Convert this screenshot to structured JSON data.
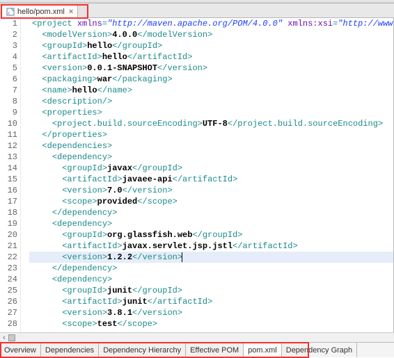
{
  "tab": {
    "label": "hello/pom.xml",
    "close": "×"
  },
  "lines": [
    {
      "n": 1,
      "segs": [
        {
          "c": "t-tag",
          "t": "<project "
        },
        {
          "c": "t-attr",
          "t": "xmlns"
        },
        {
          "c": "t-tag",
          "t": "="
        },
        {
          "c": "t-str",
          "t": "\"http://maven.apache.org/POM/4.0.0\""
        },
        {
          "c": "t-tag",
          "t": " "
        },
        {
          "c": "t-attr",
          "t": "xmlns:xsi"
        },
        {
          "c": "t-tag",
          "t": "="
        },
        {
          "c": "t-str",
          "t": "\"http://www.w"
        }
      ],
      "i": 0
    },
    {
      "n": 2,
      "segs": [
        {
          "c": "t-tag",
          "t": "<modelVersion>"
        },
        {
          "c": "t-text",
          "t": "4.0.0"
        },
        {
          "c": "t-tag",
          "t": "</modelVersion>"
        }
      ],
      "i": 1
    },
    {
      "n": 3,
      "segs": [
        {
          "c": "t-tag",
          "t": "<groupId>"
        },
        {
          "c": "t-text",
          "t": "hello"
        },
        {
          "c": "t-tag",
          "t": "</groupId>"
        }
      ],
      "i": 1
    },
    {
      "n": 4,
      "segs": [
        {
          "c": "t-tag",
          "t": "<artifactId>"
        },
        {
          "c": "t-text",
          "t": "hello"
        },
        {
          "c": "t-tag",
          "t": "</artifactId>"
        }
      ],
      "i": 1
    },
    {
      "n": 5,
      "segs": [
        {
          "c": "t-tag",
          "t": "<version>"
        },
        {
          "c": "t-text",
          "t": "0.0.1-SNAPSHOT"
        },
        {
          "c": "t-tag",
          "t": "</version>"
        }
      ],
      "i": 1
    },
    {
      "n": 6,
      "segs": [
        {
          "c": "t-tag",
          "t": "<packaging>"
        },
        {
          "c": "t-text",
          "t": "war"
        },
        {
          "c": "t-tag",
          "t": "</packaging>"
        }
      ],
      "i": 1
    },
    {
      "n": 7,
      "segs": [
        {
          "c": "t-tag",
          "t": "<name>"
        },
        {
          "c": "t-text",
          "t": "hello"
        },
        {
          "c": "t-tag",
          "t": "</name>"
        }
      ],
      "i": 1
    },
    {
      "n": 8,
      "segs": [
        {
          "c": "t-tag",
          "t": "<description/>"
        }
      ],
      "i": 1
    },
    {
      "n": 9,
      "segs": [
        {
          "c": "t-tag",
          "t": "<properties>"
        }
      ],
      "i": 1
    },
    {
      "n": 10,
      "segs": [
        {
          "c": "t-tag",
          "t": "<project.build.sourceEncoding>"
        },
        {
          "c": "t-text",
          "t": "UTF-8"
        },
        {
          "c": "t-tag",
          "t": "</project.build.sourceEncoding>"
        }
      ],
      "i": 2
    },
    {
      "n": 11,
      "segs": [
        {
          "c": "t-tag",
          "t": "</properties>"
        }
      ],
      "i": 1
    },
    {
      "n": 12,
      "segs": [
        {
          "c": "t-tag",
          "t": "<dependencies>"
        }
      ],
      "i": 1
    },
    {
      "n": 13,
      "segs": [
        {
          "c": "t-tag",
          "t": "<dependency>"
        }
      ],
      "i": 2
    },
    {
      "n": 14,
      "segs": [
        {
          "c": "t-tag",
          "t": "<groupId>"
        },
        {
          "c": "t-text",
          "t": "javax"
        },
        {
          "c": "t-tag",
          "t": "</groupId>"
        }
      ],
      "i": 3
    },
    {
      "n": 15,
      "segs": [
        {
          "c": "t-tag",
          "t": "<artifactId>"
        },
        {
          "c": "t-text",
          "t": "javaee-api"
        },
        {
          "c": "t-tag",
          "t": "</artifactId>"
        }
      ],
      "i": 3
    },
    {
      "n": 16,
      "segs": [
        {
          "c": "t-tag",
          "t": "<version>"
        },
        {
          "c": "t-text",
          "t": "7.0"
        },
        {
          "c": "t-tag",
          "t": "</version>"
        }
      ],
      "i": 3
    },
    {
      "n": 17,
      "segs": [
        {
          "c": "t-tag",
          "t": "<scope>"
        },
        {
          "c": "t-text",
          "t": "provided"
        },
        {
          "c": "t-tag",
          "t": "</scope>"
        }
      ],
      "i": 3
    },
    {
      "n": 18,
      "segs": [
        {
          "c": "t-tag",
          "t": "</dependency>"
        }
      ],
      "i": 2
    },
    {
      "n": 19,
      "segs": [
        {
          "c": "t-tag",
          "t": "<dependency>"
        }
      ],
      "i": 2
    },
    {
      "n": 20,
      "segs": [
        {
          "c": "t-tag",
          "t": "<groupId>"
        },
        {
          "c": "t-text",
          "t": "org.glassfish.web"
        },
        {
          "c": "t-tag",
          "t": "</groupId>"
        }
      ],
      "i": 3
    },
    {
      "n": 21,
      "segs": [
        {
          "c": "t-tag",
          "t": "<artifactId>"
        },
        {
          "c": "t-text",
          "t": "javax.servlet.jsp.jstl"
        },
        {
          "c": "t-tag",
          "t": "</artifactId>"
        }
      ],
      "i": 3
    },
    {
      "n": 22,
      "segs": [
        {
          "c": "t-tag",
          "t": "<version>"
        },
        {
          "c": "t-text",
          "t": "1.2.2"
        },
        {
          "c": "t-tag",
          "t": "</version>"
        },
        {
          "c": "caret",
          "t": ""
        }
      ],
      "i": 3,
      "hl": true
    },
    {
      "n": 23,
      "segs": [
        {
          "c": "t-tag",
          "t": "</dependency>"
        }
      ],
      "i": 2
    },
    {
      "n": 24,
      "segs": [
        {
          "c": "t-tag",
          "t": "<dependency>"
        }
      ],
      "i": 2
    },
    {
      "n": 25,
      "segs": [
        {
          "c": "t-tag",
          "t": "<groupId>"
        },
        {
          "c": "t-text",
          "t": "junit"
        },
        {
          "c": "t-tag",
          "t": "</groupId>"
        }
      ],
      "i": 3
    },
    {
      "n": 26,
      "segs": [
        {
          "c": "t-tag",
          "t": "<artifactId>"
        },
        {
          "c": "t-text",
          "t": "junit"
        },
        {
          "c": "t-tag",
          "t": "</artifactId>"
        }
      ],
      "i": 3
    },
    {
      "n": 27,
      "segs": [
        {
          "c": "t-tag",
          "t": "<version>"
        },
        {
          "c": "t-text",
          "t": "3.8.1"
        },
        {
          "c": "t-tag",
          "t": "</version>"
        }
      ],
      "i": 3
    },
    {
      "n": 28,
      "segs": [
        {
          "c": "t-tag",
          "t": "<scope>"
        },
        {
          "c": "t-text",
          "t": "test"
        },
        {
          "c": "t-tag",
          "t": "</scope>"
        }
      ],
      "i": 3
    }
  ],
  "bottomTabs": [
    {
      "label": "Overview",
      "sel": false
    },
    {
      "label": "Dependencies",
      "sel": false
    },
    {
      "label": "Dependency Hierarchy",
      "sel": false
    },
    {
      "label": "Effective POM",
      "sel": false
    },
    {
      "label": "pom.xml",
      "sel": true
    },
    {
      "label": "Dependency Graph",
      "sel": false
    }
  ],
  "scroll_larrow": "‹"
}
